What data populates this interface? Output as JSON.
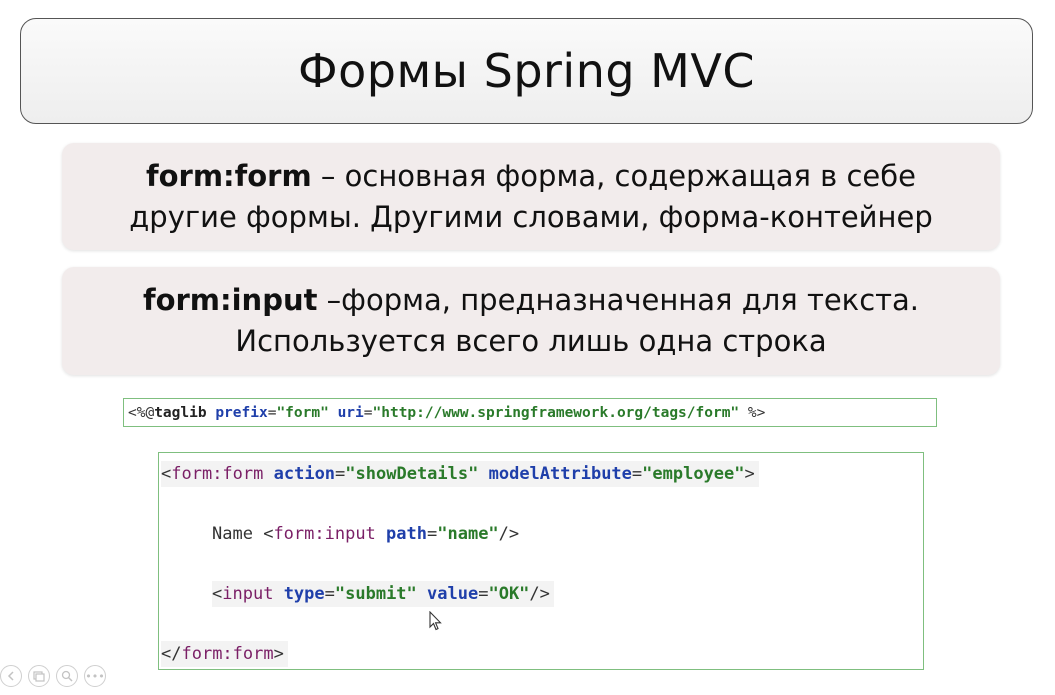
{
  "slide": {
    "title": "Формы Spring MVC",
    "definitions": [
      {
        "term": "form:form",
        "text_line1": " – основная форма, содержащая в себе",
        "text_line2": "другие формы. Другими словами, форма-контейнер"
      },
      {
        "term": "form:input",
        "text_line1": " –форма, предназначенная для текста.",
        "text_line2": "Используется всего лишь одна строка"
      }
    ]
  },
  "taglib": {
    "open": "<%@",
    "directive": "taglib",
    "prefix_attr": "prefix",
    "prefix_val": "\"form\"",
    "uri_attr": "uri",
    "uri_val": "\"http://www.springframework.org/tags/form\"",
    "close": "%>"
  },
  "code": {
    "line1": {
      "open": "<",
      "tag": "form:form",
      "attr1": "action",
      "val1": "\"showDetails\"",
      "attr2": "modelAttribute",
      "val2": "\"employee\"",
      "close": ">"
    },
    "line2": {
      "text": "Name ",
      "open": "<",
      "tag": "form:input",
      "attr1": "path",
      "val1": "\"name\"",
      "close": "/>"
    },
    "line3": {
      "open": "<",
      "tag": "input",
      "attr1": "type",
      "val1": "\"submit\"",
      "attr2": "value",
      "val2": "\"OK\"",
      "close": "/>"
    },
    "line4": {
      "open": "</",
      "tag": "form:form",
      "close": ">"
    }
  },
  "nav": {
    "icons": [
      "previous-slide-icon",
      "slides-icon",
      "zoom-icon",
      "more-options-icon"
    ],
    "more_label": "•••"
  },
  "colors": {
    "tag": "#7a1f66",
    "attribute": "#1f3faa",
    "value": "#2a7a2a",
    "code_border": "#7fbf7f",
    "definition_bg": "#f2ecec"
  }
}
